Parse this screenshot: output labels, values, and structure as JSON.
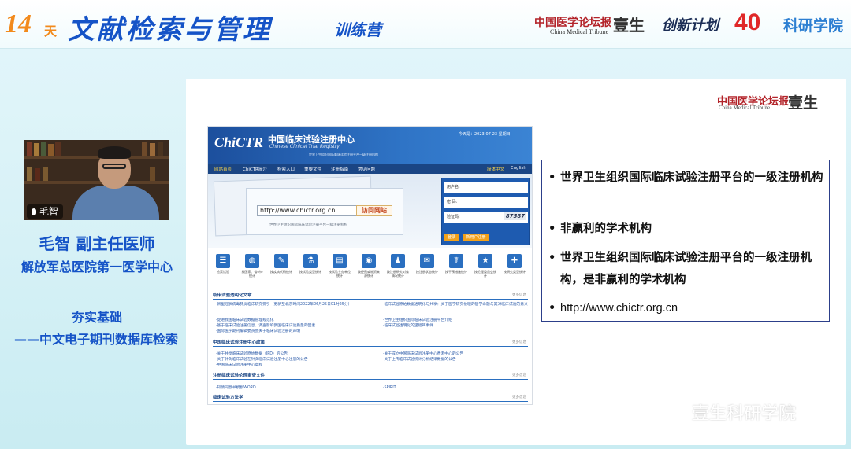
{
  "course": {
    "num": "14",
    "day": "天",
    "title": "文献检索与管理",
    "subtitle": "训练营"
  },
  "sponsors": {
    "cmt_cn": "中国医学论坛报",
    "cmt_en": "China Medical Tribune",
    "yisheng": "壹生",
    "chuangxin": "创新计划",
    "forty": "40",
    "kyy": "科研学院"
  },
  "speaker": {
    "tag": "毛智",
    "name": "毛智  副主任医师",
    "org": "解放军总医院第一医学中心"
  },
  "topic": {
    "line1": "夯实基础",
    "line2": "——中文电子期刊数据库检索"
  },
  "slide": {
    "logo_cmt": "中国医学论坛报",
    "logo_cmt_en": "China Medical Tribune",
    "logo_ys": "壹生",
    "site": {
      "logo": "ChiCTR",
      "title_cn": "中国临床试验注册中心",
      "title_en": "Chinese Clinical Trial Registry",
      "tagline": "世界卫生组织国际临床试验注册平台一级注册机构",
      "date": "今天是：2023-07-23 星期日",
      "nav": [
        "网站首页",
        "ChiCTR简介",
        "检索入口",
        "重要文件",
        "注册指南",
        "常见问题"
      ],
      "lang_cn": "简体中文",
      "lang_en": "English",
      "hero_url": "http://www.chictr.org.cn",
      "hero_go": "访问网站",
      "hero_caption": "世界卫生组织国际临床试验注册平台一级注册机构",
      "login": {
        "user": "用户名:",
        "password": "密    码:",
        "captcha_label": "验证码:",
        "captcha": "87587",
        "login_btn": "登录",
        "register_btn": "新用户注册"
      },
      "icons": [
        {
          "glyph": "☰",
          "label": "检索试验"
        },
        {
          "glyph": "◍",
          "label": "按国家、省(市)统计"
        },
        {
          "glyph": "✎",
          "label": "按疾病代码统计"
        },
        {
          "glyph": "⚗",
          "label": "按试验类型统计"
        },
        {
          "glyph": "▤",
          "label": "按试验主办单位统计"
        },
        {
          "glyph": "◉",
          "label": "按经费或物资来源统计"
        },
        {
          "glyph": "♟",
          "label": "按注册研究对象情况统计"
        },
        {
          "glyph": "✉",
          "label": "按注册状态统计"
        },
        {
          "glyph": "☤",
          "label": "按干预措施统计"
        },
        {
          "glyph": "★",
          "label": "按伦理委员会统计"
        },
        {
          "glyph": "✚",
          "label": "按研究类型统计"
        }
      ],
      "sec1": {
        "title": "临床试验透明化文章",
        "more": "更多信息",
        "left": [
          "·新型冠状病毒肺炎临床研究要引（更新至北京时间2022年06月25日01时25分）",
          "·促进我国临床试验数据管理规范化",
          "·基于临床试验注册信息、调查影响我国临床试验质量的因素",
          "·国际医学期刊编辑委员会关于临床试验注册的声明"
        ],
        "right": [
          "·临床试验原始数据透明化与共享：关于医学研究伦理的哲学命题与其对临床试验的意义",
          "·世界卫生组织国际临床试验注册平台介绍",
          "·临床试验透明化的里程碑事件"
        ]
      },
      "sec2": {
        "title": "中国临床试验注册中心政策",
        "more": "更多信息",
        "left": [
          "·关于共享临床试验原始数据（IPD）的公告",
          "·关于针灸临床试验在针灸临床试验注册中心注册的公告",
          "·中国临床试验注册中心章程"
        ],
        "right": [
          "·关于成立中国临床试验注册中心香港中心的公告",
          "·关于上传临床试验统计分析结果数据的公告"
        ]
      },
      "sec3": {
        "title": "注册临床试验伦理审查文件",
        "more": "更多信息",
        "left": [
          "·知情同意书模板WORD"
        ],
        "right": [
          "·SPIRIT"
        ]
      },
      "sec4": {
        "title": "临床试验方法学",
        "more": "更多信息"
      }
    },
    "bullets": [
      {
        "text": "世界卫生组织国际临床试验注册平台的一级注册机构"
      },
      {
        "text": "非赢利的学术机构"
      },
      {
        "text": "世界卫生组织国际临床试验注册平台的一级注册机构，是非赢利的学术机构"
      },
      {
        "text": "http://www.chictr.org.cn"
      }
    ],
    "bullet_char": "•"
  },
  "watermark": "壹生科研学院"
}
